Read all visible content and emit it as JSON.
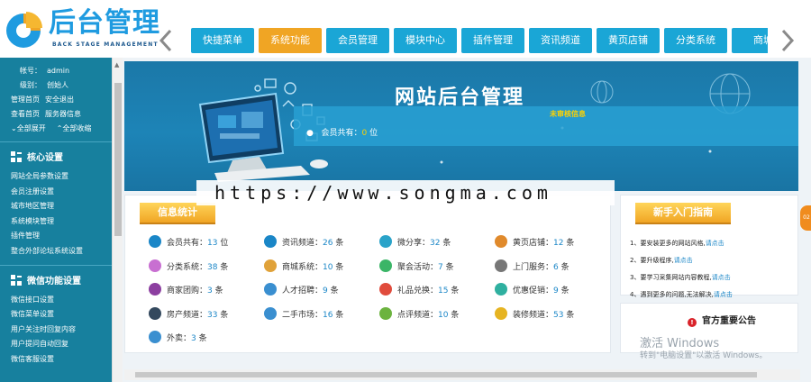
{
  "logo": {
    "title": "后台管理",
    "subtitle": "BACK STAGE MANAGEMENT"
  },
  "nav": {
    "tabs": [
      {
        "label": "快捷菜单",
        "active": false
      },
      {
        "label": "系统功能",
        "active": true
      },
      {
        "label": "会员管理",
        "active": false
      },
      {
        "label": "模块中心",
        "active": false
      },
      {
        "label": "插件管理",
        "active": false
      },
      {
        "label": "资讯频道",
        "active": false
      },
      {
        "label": "黄页店铺",
        "active": false
      },
      {
        "label": "分类系统",
        "active": false
      },
      {
        "label": "商城",
        "active": false
      }
    ]
  },
  "sidebar": {
    "account_label": "帐号：",
    "account_value": "admin",
    "level_label": "级别：",
    "level_value": "创始人",
    "links": [
      [
        "管理首页",
        "安全退出"
      ],
      [
        "查看首页",
        "服务器信息"
      ],
      [
        "全部展开",
        "全部收缩"
      ]
    ],
    "sections": [
      {
        "title": "核心设置",
        "items": [
          "网站全局参数设置",
          "会员注册设置",
          "城市地区管理",
          "系统模块管理",
          "插件管理",
          "整合外部论坛系统设置"
        ]
      },
      {
        "title": "微信功能设置",
        "items": [
          "微信接口设置",
          "微信菜单设置",
          "用户关注时回复内容",
          "用户提问自动回复",
          "微信客服设置"
        ]
      }
    ]
  },
  "banner": {
    "title": "网站后台管理",
    "pending": "未审核信息",
    "members_label": "会员共有：",
    "members_count": "0",
    "members_unit": "位"
  },
  "info": {
    "title": "信息统计",
    "stats": [
      {
        "icon": "toggle-icon",
        "color": "#1a86c7",
        "label": "会员共有：",
        "value": "13",
        "unit": "位"
      },
      {
        "icon": "globe-icon",
        "color": "#1a86c7",
        "label": "资讯频道：",
        "value": "26",
        "unit": "条"
      },
      {
        "icon": "share-icon",
        "color": "#2aa3c9",
        "label": "微分享：",
        "value": "32",
        "unit": "条"
      },
      {
        "icon": "book-icon",
        "color": "#e08a2c",
        "label": "黄页店铺：",
        "value": "12",
        "unit": "条"
      },
      {
        "icon": "flower-icon",
        "color": "#c86fd1",
        "label": "分类系统：",
        "value": "38",
        "unit": "条"
      },
      {
        "icon": "shop-icon",
        "color": "#e0a23a",
        "label": "商城系统：",
        "value": "10",
        "unit": "条"
      },
      {
        "icon": "group-icon",
        "color": "#3bb567",
        "label": "聚会活动：",
        "value": "7",
        "unit": "条"
      },
      {
        "icon": "doc-icon",
        "color": "#777777",
        "label": "上门服务：",
        "value": "6",
        "unit": "条"
      },
      {
        "icon": "group-buy-icon",
        "color": "#8c3fa0",
        "label": "商家团购：",
        "value": "3",
        "unit": "条"
      },
      {
        "icon": "job-icon",
        "color": "#3a8fd0",
        "label": "人才招聘：",
        "value": "9",
        "unit": "条"
      },
      {
        "icon": "gift-icon",
        "color": "#e04b3c",
        "label": "礼品兑换：",
        "value": "15",
        "unit": "条"
      },
      {
        "icon": "coupon-icon",
        "color": "#2fb0a0",
        "label": "优惠促销：",
        "value": "9",
        "unit": "条"
      },
      {
        "icon": "building-icon",
        "color": "#34495e",
        "label": "房产频道：",
        "value": "33",
        "unit": "条"
      },
      {
        "icon": "recycle-icon",
        "color": "#3a8fd0",
        "label": "二手市场：",
        "value": "16",
        "unit": "条"
      },
      {
        "icon": "cup-icon",
        "color": "#6cb33f",
        "label": "点评频道：",
        "value": "10",
        "unit": "条"
      },
      {
        "icon": "brush-icon",
        "color": "#e6b422",
        "label": "装修频道：",
        "value": "53",
        "unit": "条"
      },
      {
        "icon": "refresh-icon",
        "color": "#3a8fd0",
        "label": "外卖：",
        "value": "3",
        "unit": "条"
      }
    ]
  },
  "guide": {
    "title": "新手入门指南",
    "items": [
      {
        "text": "1、要安装更多的网站风格,",
        "link": "请点击"
      },
      {
        "text": "2、要升级程序,",
        "link": "请点击"
      },
      {
        "text": "3、要学习采集网站内容教程,",
        "link": "请点击"
      },
      {
        "text": "4、遇到更多的问题,无法解决,",
        "link": "请点击"
      }
    ]
  },
  "notice": {
    "title": "官方重要公告"
  },
  "overlay": {
    "url": "https://www.songma.com"
  },
  "watermark": {
    "line1": "激活 Windows",
    "line2": "转到\"电脑设置\"以激活 Windows。"
  },
  "side_tab": "02"
}
